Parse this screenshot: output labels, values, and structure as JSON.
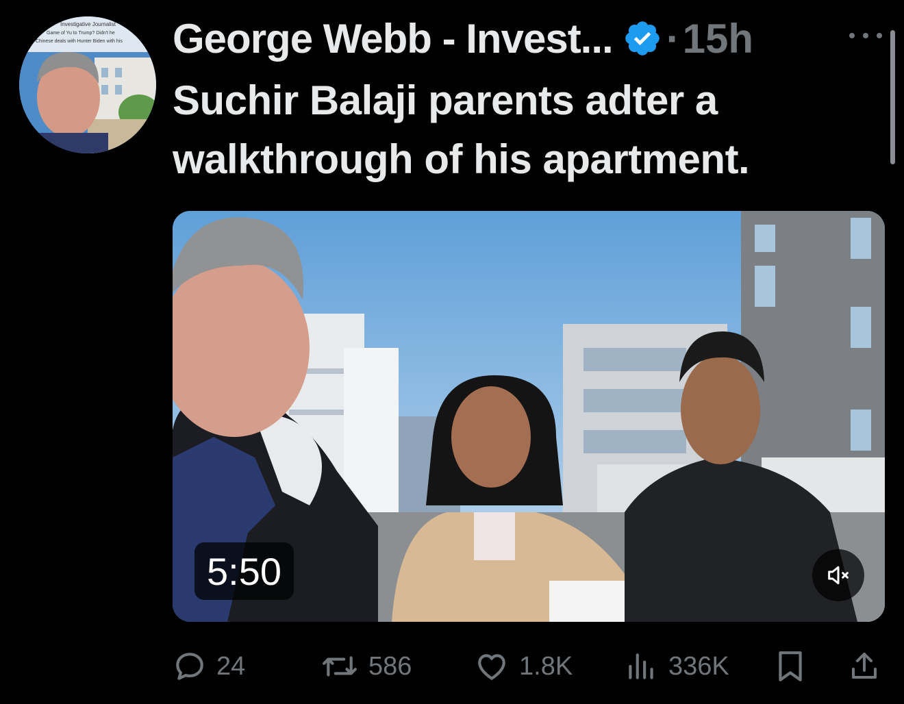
{
  "tweet": {
    "author_name": "George Webb - Invest...",
    "verified_icon": "verified-badge-icon",
    "separator": "·",
    "timestamp": "15h",
    "text": "Suchir Balaji parents adter a walkthrough of his apartment.",
    "accent_color": "#1d9bf0"
  },
  "avatar": {
    "banner_lines": [
      "Investigative Journalist",
      "Game of Yu to Trump? Didn't he",
      "Chinese deals with Hunter Biden with his"
    ]
  },
  "media": {
    "type": "video",
    "duration": "5:50",
    "mute_icon": "speaker-muted-icon"
  },
  "actions": {
    "reply": {
      "icon": "reply-bubble-icon",
      "count": "24"
    },
    "retweet": {
      "icon": "retweet-icon",
      "count": "586"
    },
    "like": {
      "icon": "heart-icon",
      "count": "1.8K"
    },
    "views": {
      "icon": "views-bar-chart-icon",
      "count": "336K"
    },
    "bookmark": {
      "icon": "bookmark-icon"
    },
    "share": {
      "icon": "share-upload-icon"
    }
  },
  "colors": {
    "background": "#000000",
    "primary_text": "#e7e9ea",
    "secondary_text": "#71767b"
  }
}
